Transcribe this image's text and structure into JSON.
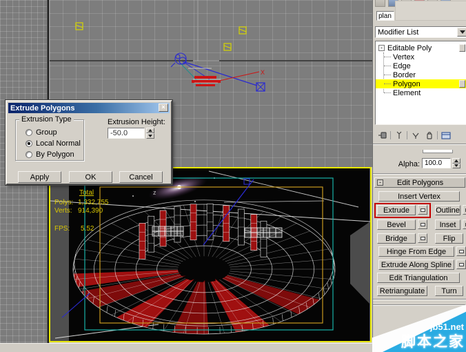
{
  "command_panel": {
    "object_name": "plan",
    "modifier_list": {
      "label": "Modifier List"
    },
    "stack": {
      "root": "Editable Poly",
      "collapse_glyph": "-",
      "items": [
        "Vertex",
        "Edge",
        "Border",
        "Polygon",
        "Element"
      ],
      "selected": "Polygon"
    },
    "stack_toolbar_icons": [
      "pin-stack",
      "show-end-result",
      "make-unique",
      "remove-modifier",
      "configure-modifier-sets"
    ],
    "alpha": {
      "label": "Alpha:",
      "value": "100.0"
    },
    "edit_polygons": {
      "title": "Edit Polygons",
      "collapse_glyph": "-",
      "insert_vertex": "Insert Vertex",
      "extrude": "Extrude",
      "outline": "Outline",
      "bevel": "Bevel",
      "inset": "Inset",
      "bridge": "Bridge",
      "flip": "Flip",
      "hinge_from_edge": "Hinge From Edge",
      "extrude_along_spline": "Extrude Along Spline",
      "edit_triangulation": "Edit Triangulation",
      "retriangulate": "Retriangulate",
      "turn": "Turn"
    }
  },
  "dialog": {
    "title": "Extrude Polygons",
    "close_glyph": "×",
    "extrusion_type": {
      "label": "Extrusion Type",
      "options": [
        {
          "label": "Group",
          "selected": false
        },
        {
          "label": "Local Normal",
          "selected": true
        },
        {
          "label": "By Polygon",
          "selected": false
        }
      ]
    },
    "extrusion_height": {
      "label": "Extrusion Height:",
      "value": "-50.0"
    },
    "apply_label": "Apply",
    "ok_label": "OK",
    "cancel_label": "Cancel"
  },
  "viewport": {
    "stats": {
      "total_label": "Total",
      "polys_label": "Polys:",
      "polys_value": "1,332,755",
      "verts_label": "Verts:",
      "verts_value": "914,390",
      "fps_label": "FPS:",
      "fps_value": "5.52"
    },
    "axis_z": "z",
    "axis_x": "X"
  },
  "watermark": {
    "site": "jb51.net",
    "name": "脚本之家"
  },
  "colors": {
    "selection_highlight": "#ffff00",
    "annotation_red": "#c40000",
    "active_viewport_border": "#e8e800",
    "safe_frame_outer": "#18b2a8",
    "safe_frame_inner": "#c89a1e",
    "selected_faces_red": "#9c1010",
    "stats_text_yellow": "#d8c500",
    "watermark_banner": "#2aabe2",
    "dialog_title_gradient_start": "#0a246a",
    "dialog_title_gradient_end": "#a6caf0"
  }
}
